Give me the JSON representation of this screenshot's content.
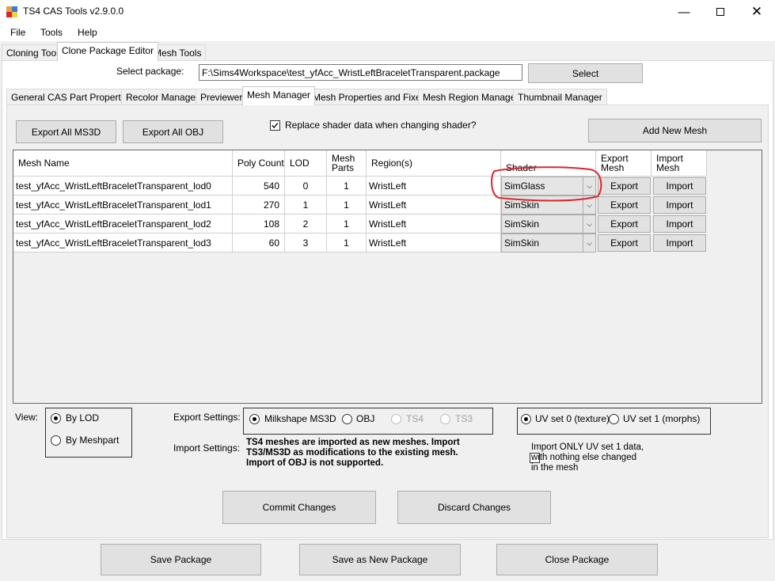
{
  "window": {
    "title": "TS4 CAS Tools v2.9.0.0"
  },
  "menu": {
    "file": "File",
    "tools": "Tools",
    "help": "Help"
  },
  "top_tabs": [
    "Cloning Tool",
    "Clone Package Editor",
    "Mesh Tools"
  ],
  "package": {
    "label": "Select package:",
    "path": "F:\\Sims4Workspace\\test_yfAcc_WristLeftBraceletTransparent.package",
    "select_button": "Select"
  },
  "sub_tabs": [
    "General CAS Part Properties",
    "Recolor Manager",
    "Previewer",
    "Mesh Manager",
    "Mesh Properties and Fixers",
    "Mesh Region Manager",
    "Thumbnail Manager"
  ],
  "toolbar": {
    "export_ms3d": "Export All MS3D",
    "export_obj": "Export All OBJ",
    "replace_shader_label": "Replace shader data when changing shader?",
    "add_mesh": "Add New Mesh"
  },
  "grid": {
    "columns": [
      "Mesh Name",
      "Poly Count",
      "LOD",
      "Mesh\nParts",
      "Region(s)",
      "Shader",
      "Export\nMesh",
      "Import\nMesh"
    ],
    "rows": [
      {
        "name": "test_yfAcc_WristLeftBraceletTransparent_lod0",
        "poly": "540",
        "lod": "0",
        "parts": "1",
        "region": "WristLeft",
        "shader": "SimGlass",
        "export": "Export",
        "import": "Import"
      },
      {
        "name": "test_yfAcc_WristLeftBraceletTransparent_lod1",
        "poly": "270",
        "lod": "1",
        "parts": "1",
        "region": "WristLeft",
        "shader": "SimSkin",
        "export": "Export",
        "import": "Import"
      },
      {
        "name": "test_yfAcc_WristLeftBraceletTransparent_lod2",
        "poly": "108",
        "lod": "2",
        "parts": "1",
        "region": "WristLeft",
        "shader": "SimSkin",
        "export": "Export",
        "import": "Import"
      },
      {
        "name": "test_yfAcc_WristLeftBraceletTransparent_lod3",
        "poly": "60",
        "lod": "3",
        "parts": "1",
        "region": "WristLeft",
        "shader": "SimSkin",
        "export": "Export",
        "import": "Import"
      }
    ]
  },
  "view": {
    "label": "View:",
    "by_lod": "By LOD",
    "by_meshpart": "By Meshpart"
  },
  "export_settings": {
    "label": "Export Settings:",
    "ms3d": "Milkshape MS3D",
    "obj": "OBJ",
    "ts4": "TS4",
    "ts3": "TS3"
  },
  "uv": {
    "set0": "UV set 0 (texture)",
    "set1": "UV set 1 (morphs)",
    "import_only": "Import ONLY UV set 1 data, with nothing else changed in the mesh"
  },
  "import_settings": {
    "label": "Import Settings:",
    "note": "TS4 meshes are imported as new meshes. Import TS3/MS3D as modifications to the existing mesh. Import of OBJ is not supported."
  },
  "actions": {
    "commit": "Commit Changes",
    "discard": "Discard Changes"
  },
  "footer": {
    "save": "Save Package",
    "save_new": "Save as New Package",
    "close": "Close Package"
  },
  "colors": {
    "highlight": "#d9272e",
    "grid_bg": "#f0f0f0"
  }
}
